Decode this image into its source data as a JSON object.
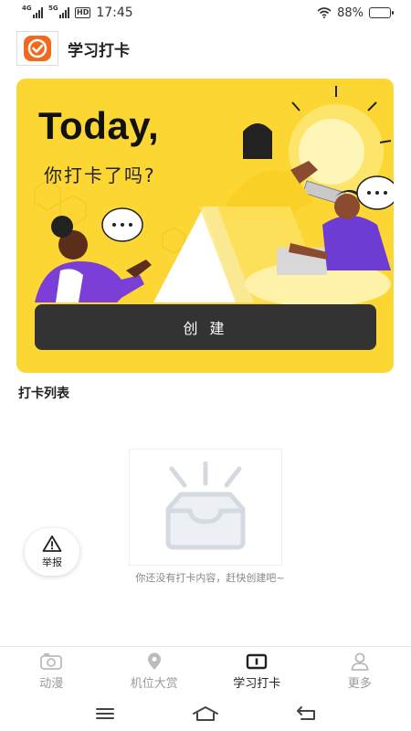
{
  "status_bar": {
    "time": "17:45",
    "network_1": "4G",
    "network_2": "5G",
    "hd_badge": "HD",
    "battery_text": "88%",
    "battery_level": 0.88
  },
  "header": {
    "title": "学习打卡",
    "logo_icon": "checkmark-badge-icon"
  },
  "banner": {
    "headline": "Today,",
    "subheadline": "你打卡了吗?",
    "create_button_label": "创 建",
    "background_color": "#fcd733"
  },
  "list": {
    "section_title": "打卡列表",
    "empty_text": "你还没有打卡内容，赶快创建吧~",
    "empty_icon": "empty-inbox-icon"
  },
  "report_button": {
    "label": "举报",
    "icon": "warning-icon"
  },
  "bottom_nav": {
    "items": [
      {
        "label": "动漫",
        "icon": "camera-icon",
        "active": false
      },
      {
        "label": "机位大赏",
        "icon": "location-pin-icon",
        "active": false
      },
      {
        "label": "学习打卡",
        "icon": "checkin-card-icon",
        "active": true
      },
      {
        "label": "更多",
        "icon": "person-icon",
        "active": false
      }
    ]
  },
  "system_nav": {
    "icons": [
      "menu-icon",
      "home-icon",
      "back-icon"
    ]
  },
  "colors": {
    "accent": "#fcd733",
    "button_dark": "#333333",
    "logo_orange": "#f0691e"
  }
}
